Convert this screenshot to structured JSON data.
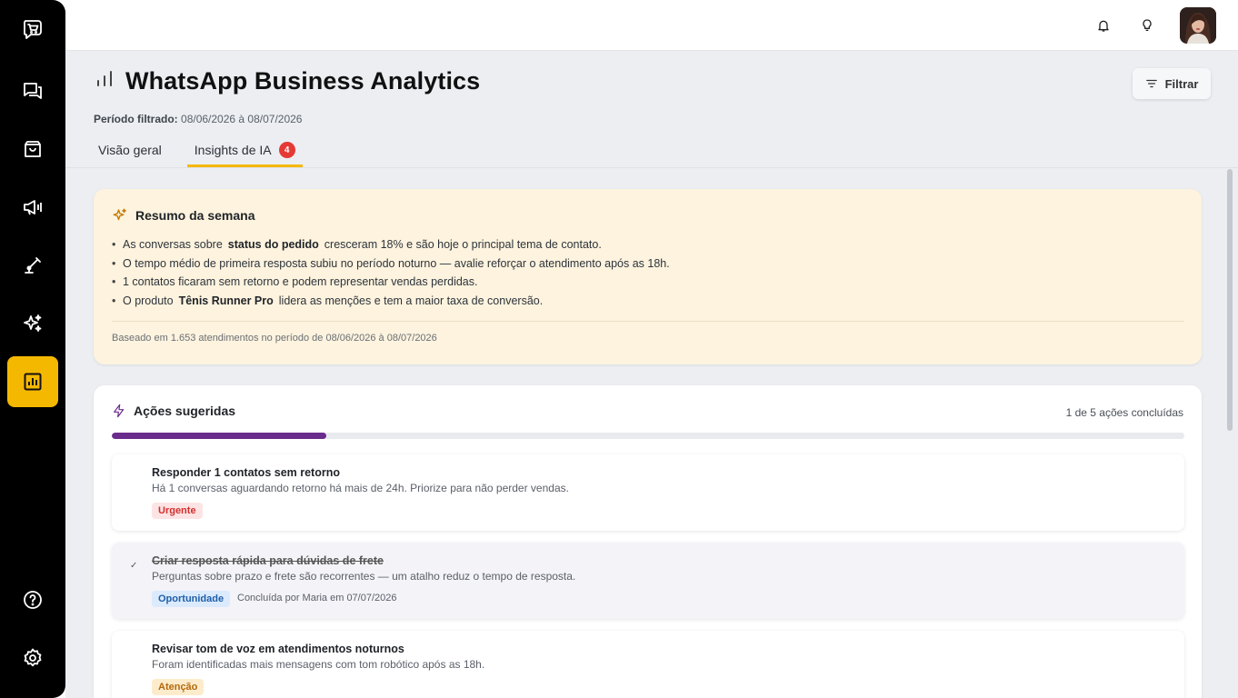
{
  "header": {
    "title": "WhatsApp Business Analytics",
    "period_label": "Período filtrado:",
    "period_value": "08/06/2026 à 08/07/2026",
    "filter_label": "Filtrar",
    "tabs": [
      {
        "label": "Visão geral",
        "active": false
      },
      {
        "label": "Insights de IA",
        "active": true,
        "badge": "4"
      }
    ]
  },
  "summary": {
    "title": "Resumo da semana",
    "bullets": [
      {
        "before": "As conversas sobre",
        "bold": "status do pedido",
        "after": "cresceram 18% e são hoje o principal tema de contato."
      },
      {
        "before": "O tempo médio de primeira resposta subiu no período noturno — avalie reforçar o atendimento após as 18h.",
        "bold": "",
        "after": ""
      },
      {
        "before": "1 contatos ficaram sem retorno e podem representar vendas perdidas.",
        "bold": "",
        "after": ""
      },
      {
        "before": "O produto",
        "bold": "Tênis Runner Pro",
        "after": "lidera as menções e tem a maior taxa de conversão."
      }
    ],
    "footer": "Baseado em 1.653 atendimentos no período de 08/06/2026 à 08/07/2026"
  },
  "actions": {
    "title": "Ações sugeridas",
    "count_label": "1 de 5 ações concluídas",
    "progress_fraction": 0.2,
    "items": [
      {
        "title": "Responder 1 contatos sem retorno",
        "desc": "Há 1 conversas aguardando retorno há mais de 24h. Priorize para não perder vendas.",
        "tag": "Urgente",
        "done": false,
        "done_by": ""
      },
      {
        "title": "Criar resposta rápida para dúvidas de frete",
        "desc": "Perguntas sobre prazo e frete são recorrentes — um atalho reduz o tempo de resposta.",
        "tag": "Oportunidade",
        "done": true,
        "done_by": "Concluída por Maria em 07/07/2026"
      },
      {
        "title": "Revisar tom de voz em atendimentos noturnos",
        "desc": "Foram identificadas mais mensagens com tom robótico após as 18h.",
        "tag": "Atenção",
        "done": false,
        "done_by": ""
      }
    ]
  },
  "colors": {
    "accent": "#f5b800",
    "progress": "#6a2c8c",
    "summary_bg": "#fdf3de",
    "sidebar_bg": "#000000"
  },
  "icons": {
    "sidebar": [
      "shop-icon",
      "chat-icon",
      "bag-icon",
      "megaphone-icon",
      "robot-arm-icon",
      "sparkles-icon",
      "analytics-icon",
      "help-icon",
      "settings-icon"
    ],
    "top": [
      "bell-icon",
      "lightbulb-icon"
    ]
  }
}
